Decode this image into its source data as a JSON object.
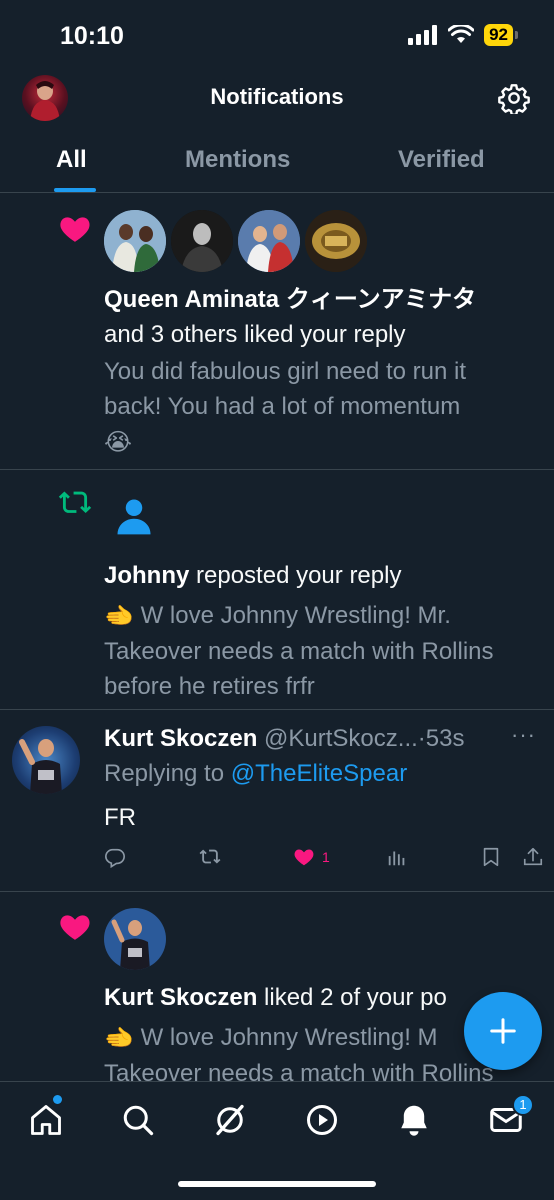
{
  "status_bar": {
    "time": "10:10",
    "battery": "92",
    "battery_color": "#ffd60a"
  },
  "header": {
    "title": "Notifications",
    "settings_icon": "gear-icon"
  },
  "tabs": [
    {
      "label": "All",
      "active": true
    },
    {
      "label": "Mentions",
      "active": false
    },
    {
      "label": "Verified",
      "active": false
    }
  ],
  "notifications": [
    {
      "type": "like",
      "icon": "heart-icon",
      "name": "Queen Aminata クィーンアミナタ",
      "action": "and 3 others liked your reply",
      "text": "You did fabulous girl need to run it back! You had a lot of momentum",
      "emoji": "😭"
    },
    {
      "type": "repost",
      "icon": "repost-icon",
      "name": "Johnny",
      "action": "reposted your reply",
      "emoji": "🫲",
      "text": "W love Johnny Wrestling! Mr. Takeover needs a match with Rollins before he retires frfr"
    },
    {
      "type": "reply",
      "name": "Kurt Skoczen",
      "handle": "@KurtSkocz...",
      "separator": "·",
      "time": "53s",
      "replying_prefix": "Replying to",
      "replying_to": "@TheEliteSpear",
      "text": "FR",
      "like_count": "1"
    },
    {
      "type": "like",
      "icon": "heart-icon",
      "name": "Kurt Skoczen",
      "action": "liked 2 of your po",
      "emoji": "🫲",
      "text": "W love Johnny Wrestling! M",
      "text2": "Takeover needs a match with Rollins"
    }
  ],
  "colors": {
    "background": "#15202b",
    "accent": "#1d9bf0",
    "like": "#f91880",
    "repost": "#00ba7c",
    "muted": "#8b98a5"
  },
  "bottom_nav": {
    "items": [
      "home-icon",
      "search-icon",
      "grok-icon",
      "play-icon",
      "bell-icon",
      "mail-icon"
    ],
    "messages_badge": "1"
  },
  "fab_icon": "plus-icon"
}
